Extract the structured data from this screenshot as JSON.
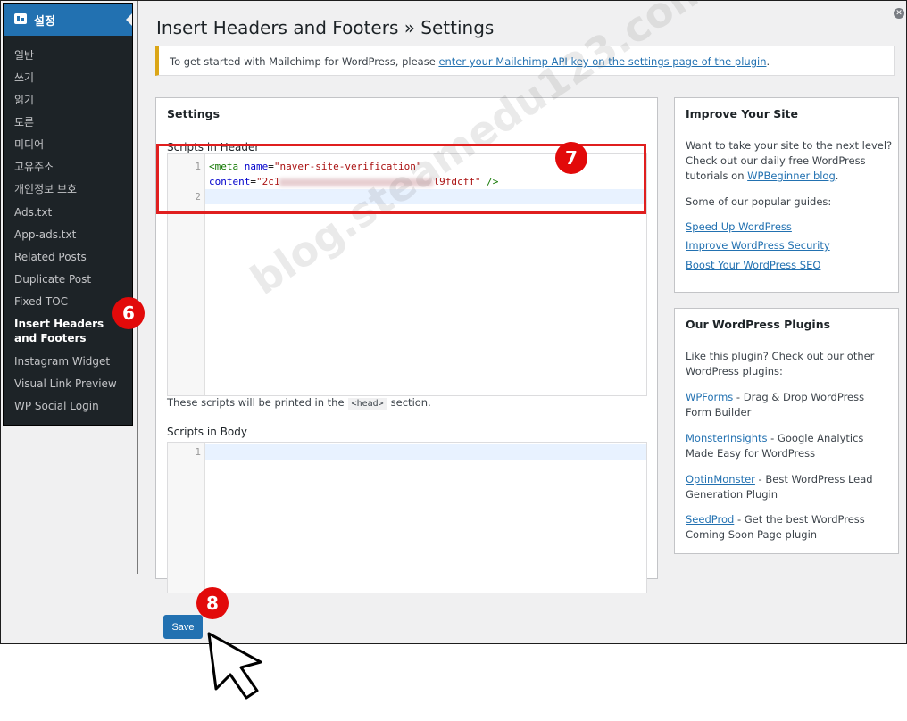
{
  "sidebar": {
    "header": "설정",
    "items": [
      {
        "label": "일반"
      },
      {
        "label": "쓰기"
      },
      {
        "label": "읽기"
      },
      {
        "label": "토론"
      },
      {
        "label": "미디어"
      },
      {
        "label": "고유주소"
      },
      {
        "label": "개인정보 보호"
      },
      {
        "label": "Ads.txt"
      },
      {
        "label": "App-ads.txt"
      },
      {
        "label": "Related Posts"
      },
      {
        "label": "Duplicate Post"
      },
      {
        "label": "Fixed TOC"
      },
      {
        "label": "Insert Headers and Footers",
        "current": true
      },
      {
        "label": "Instagram Widget"
      },
      {
        "label": "Visual Link Preview"
      },
      {
        "label": "WP Social Login"
      }
    ]
  },
  "page": {
    "title": "Insert Headers and Footers » Settings"
  },
  "notice": {
    "text": "To get started with Mailchimp for WordPress, please ",
    "link": "enter your Mailchimp API key on the settings page of the plugin",
    "end": "."
  },
  "settings": {
    "heading": "Settings",
    "header_label": "Scripts in Header",
    "header_code": {
      "line1": [
        "<meta",
        "name",
        "=",
        "\"naver-site-verification\""
      ],
      "line2_attr": "content",
      "line2_eq": "=",
      "line2_start": "\"2c1",
      "line2_end": "l9fdcff\"",
      "line2_close": "/>"
    },
    "line_numbers": [
      "1",
      "2"
    ],
    "help_before": "These scripts will be printed in the",
    "help_code": "<head>",
    "help_after": "section.",
    "body_label": "Scripts in Body",
    "body_line_numbers": [
      "1"
    ]
  },
  "improve": {
    "title": "Improve Your Site",
    "intro": "Want to take your site to the next level? Check out our daily free WordPress tutorials on ",
    "intro_link": "WPBeginner blog",
    "intro_end": ".",
    "guides_intro": "Some of our popular guides:",
    "links": [
      "Speed Up WordPress",
      "Improve WordPress Security",
      "Boost Your WordPress SEO"
    ]
  },
  "plugins": {
    "title": "Our WordPress Plugins",
    "intro": "Like this plugin? Check out our other WordPress plugins:",
    "items": [
      {
        "name": "WPForms",
        "desc": " - Drag & Drop WordPress Form Builder"
      },
      {
        "name": "MonsterInsights",
        "desc": " - Google Analytics Made Easy for WordPress"
      },
      {
        "name": "OptinMonster",
        "desc": " - Best WordPress Lead Generation Plugin"
      },
      {
        "name": "SeedProd",
        "desc": " - Get the best WordPress Coming Soon Page plugin"
      }
    ]
  },
  "save_label": "Save",
  "annotations": {
    "step6": "6",
    "step7": "7",
    "step8": "8",
    "watermark": "blog.steamedu123.com",
    "color": "#e20a0a"
  },
  "icons": {
    "menu": "settings-menu-icon",
    "close": "close-icon",
    "cursor": "mouse-pointer-icon"
  }
}
